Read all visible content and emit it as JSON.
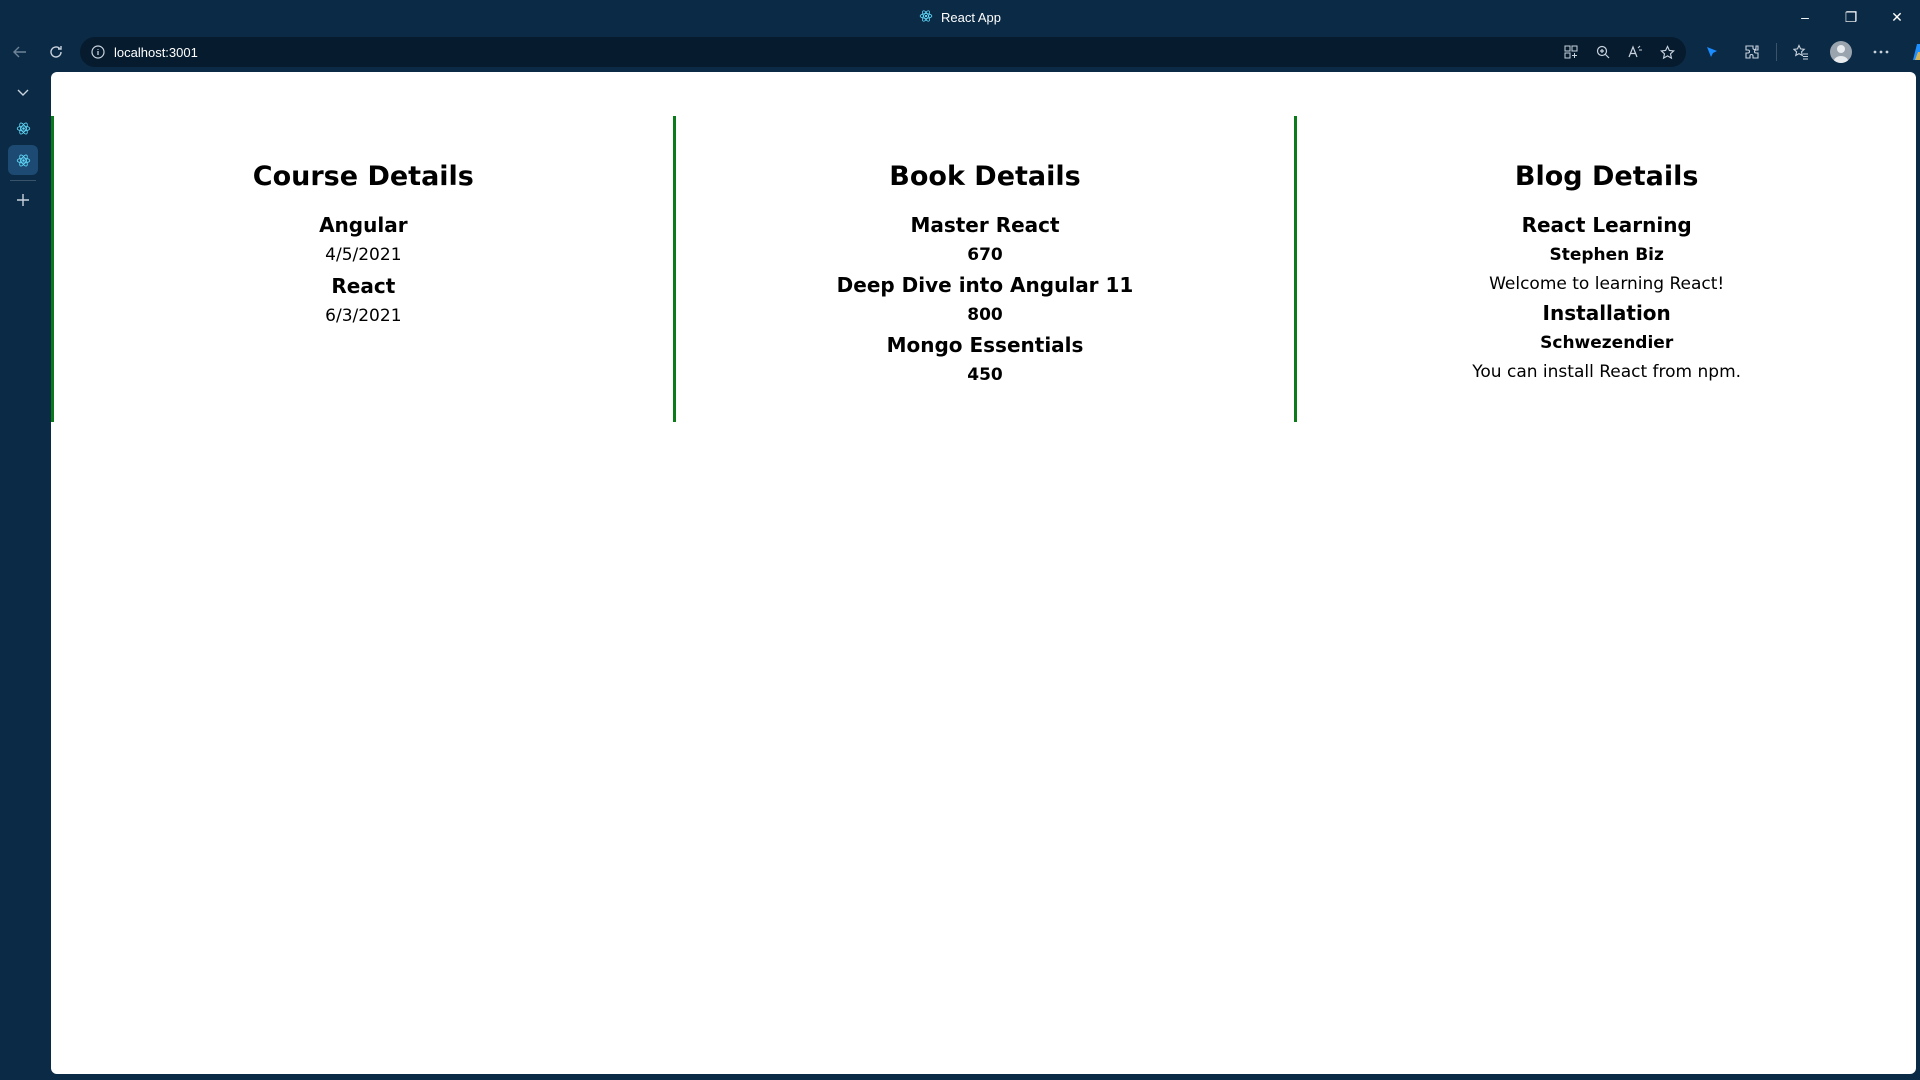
{
  "window": {
    "title": "React App",
    "favicon": "react-logo-icon",
    "controls": {
      "minimize": "–",
      "restore": "❐",
      "close": "✕"
    }
  },
  "toolbar": {
    "url": "localhost:3001",
    "icons": [
      "back-icon",
      "refresh-icon",
      "site-info-icon",
      "app-available-icon",
      "zoom-icon",
      "read-aloud-icon",
      "favorite-star-icon",
      "copilot-arrow-icon",
      "extensions-icon",
      "favorites-icon",
      "profile-icon",
      "more-icon",
      "copilot-icon"
    ]
  },
  "sidebar": {
    "items": [
      "tab-actions-icon",
      "react-tab-icon",
      "react-tab-icon",
      "new-tab-icon"
    ]
  },
  "page": {
    "courses": {
      "heading": "Course Details",
      "items": [
        {
          "name": "Angular",
          "date": "4/5/2021"
        },
        {
          "name": "React",
          "date": "6/3/2021"
        }
      ]
    },
    "books": {
      "heading": "Book Details",
      "items": [
        {
          "name": "Master React",
          "price": "670"
        },
        {
          "name": "Deep Dive into Angular 11",
          "price": "800"
        },
        {
          "name": "Mongo Essentials",
          "price": "450"
        }
      ]
    },
    "blogs": {
      "heading": "Blog Details",
      "items": [
        {
          "title": "React Learning",
          "author": "Stephen Biz",
          "content": "Welcome to learning React!"
        },
        {
          "title": "Installation",
          "author": "Schwezendier",
          "content": "You can install React from npm."
        }
      ]
    }
  },
  "colors": {
    "chrome": "#0b2a45",
    "column_border": "#0a7a1a",
    "page_bg": "#ffffff"
  }
}
